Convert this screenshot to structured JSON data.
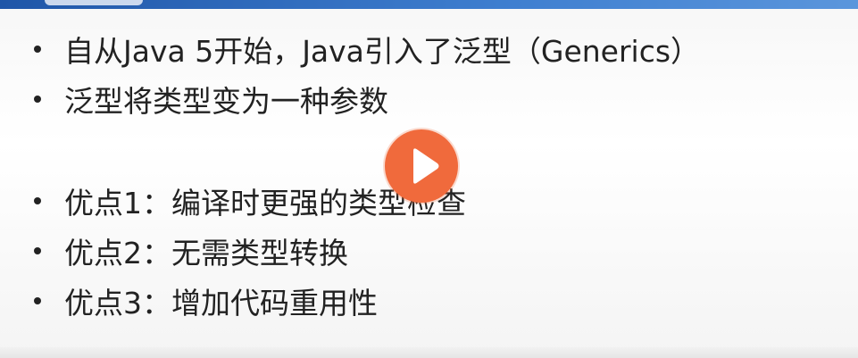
{
  "slide": {
    "bullets": [
      "自从Java 5开始，Java引入了泛型（Generics）",
      "泛型将类型变为一种参数",
      "优点1：编译时更强的类型检查",
      "优点2：无需类型转换",
      "优点3：增加代码重用性"
    ]
  },
  "player": {
    "play_icon": "play-icon",
    "accent_color": "#f06a3c"
  }
}
